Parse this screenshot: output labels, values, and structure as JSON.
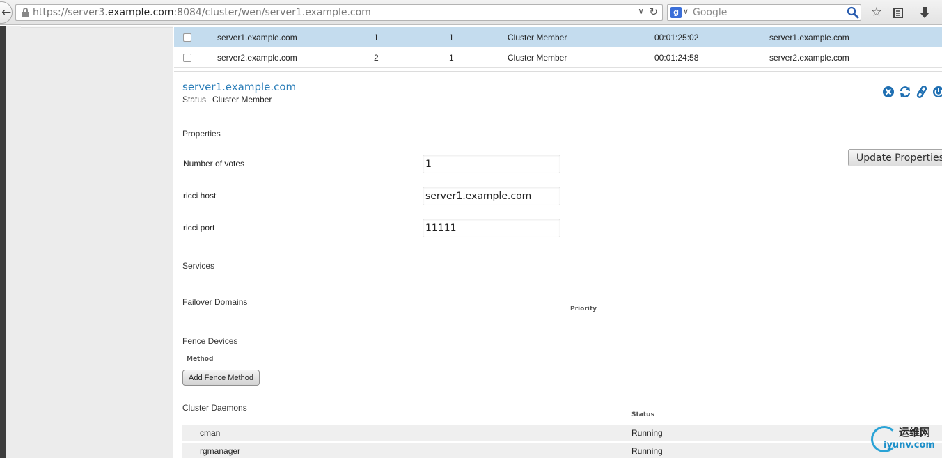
{
  "browser": {
    "url_prefix": "https://server3.",
    "url_host": "example.com",
    "url_suffix": ":8084/cluster/wen/server1.example.com",
    "search_placeholder": "Google"
  },
  "nodes": [
    {
      "name": "server1.example.com",
      "node_id": "1",
      "votes": "1",
      "status": "Cluster Member",
      "uptime": "00:01:25:02",
      "ricci_host": "server1.example.com",
      "selected": true
    },
    {
      "name": "server2.example.com",
      "node_id": "2",
      "votes": "1",
      "status": "Cluster Member",
      "uptime": "00:01:24:58",
      "ricci_host": "server2.example.com",
      "selected": false
    }
  ],
  "detail": {
    "title": "server1.example.com",
    "status_label": "Status",
    "status_value": "Cluster Member",
    "properties_heading": "Properties",
    "votes_label": "Number of votes",
    "votes_value": "1",
    "ricci_host_label": "ricci host",
    "ricci_host_value": "server1.example.com",
    "ricci_port_label": "ricci port",
    "ricci_port_value": "11111",
    "update_button": "Update Properties",
    "services_heading": "Services",
    "failover_heading": "Failover Domains",
    "priority_header": "Priority",
    "fence_heading": "Fence Devices",
    "method_header": "Method",
    "add_fence_button": "Add Fence Method",
    "daemons_heading": "Cluster Daemons",
    "daemon_status_header": "Status",
    "daemons": [
      {
        "name": "cman",
        "status": "Running"
      },
      {
        "name": "rgmanager",
        "status": "Running"
      }
    ]
  },
  "icons": {
    "action_icons": [
      "remove-icon",
      "refresh-icon",
      "link-icon",
      "power-icon"
    ],
    "accent_color": "#2a7db8"
  },
  "watermark": {
    "cn_text": "运维网",
    "en_text": "iyunv.com"
  }
}
